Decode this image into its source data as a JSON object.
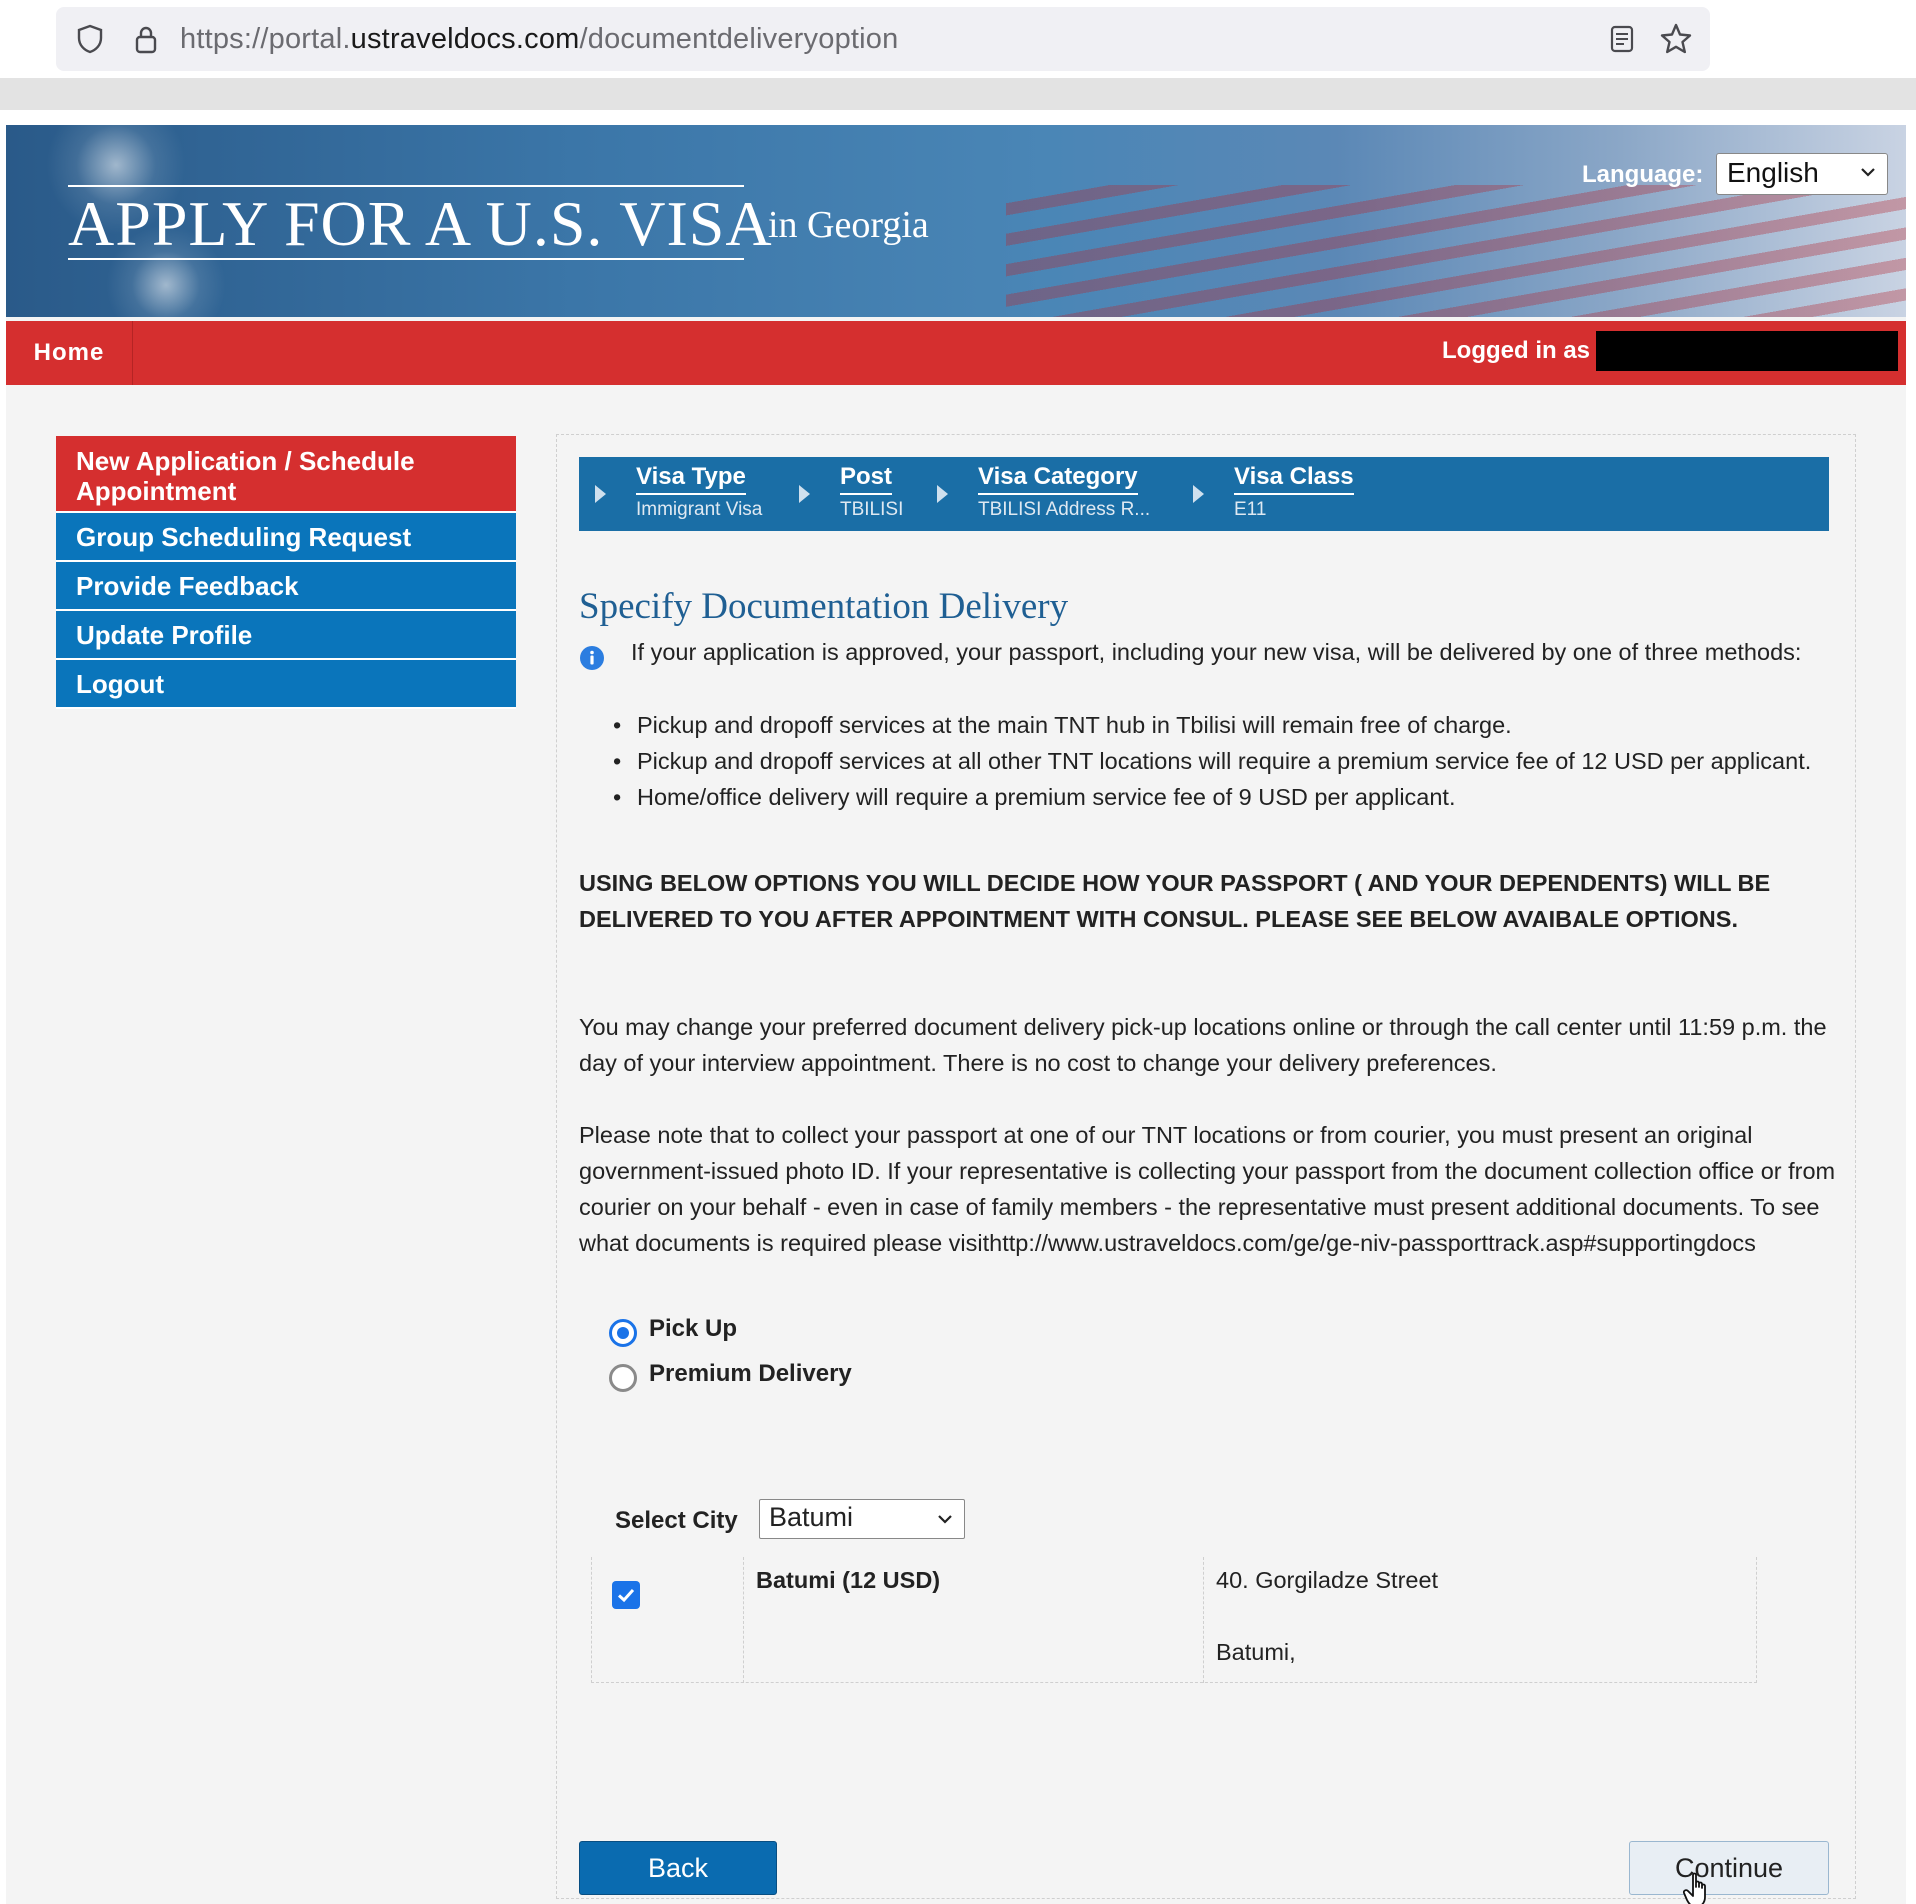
{
  "browser": {
    "url_prefix": "https://portal.",
    "url_domain": "ustraveldocs.com",
    "url_path": "/documentdeliveryoption",
    "icons": [
      "shield-icon",
      "lock-icon",
      "reader-view-icon",
      "bookmark-star-icon"
    ]
  },
  "banner": {
    "title": "APPLY FOR A U.S. VISA",
    "subtitle": "in Georgia",
    "language_label": "Language:",
    "language_value": "English"
  },
  "nav": {
    "home": "Home",
    "logged_in": "Logged in as"
  },
  "sidebar": {
    "items": [
      {
        "label": "New Application / Schedule Appointment"
      },
      {
        "label": "Group Scheduling Request"
      },
      {
        "label": "Provide Feedback"
      },
      {
        "label": "Update Profile"
      },
      {
        "label": "Logout"
      }
    ]
  },
  "breadcrumbs": [
    {
      "title": "Visa Type",
      "value": "Immigrant Visa"
    },
    {
      "title": "Post",
      "value": "TBILISI"
    },
    {
      "title": "Visa Category",
      "value": "TBILISI Address R..."
    },
    {
      "title": "Visa Class",
      "value": "E11"
    }
  ],
  "content": {
    "title": "Specify Documentation Delivery",
    "intro": "If your application is approved, your passport, including your new visa, will be delivered by one of three methods:",
    "bullets": [
      "Pickup and dropoff services at the main TNT hub in Tbilisi will remain free of charge.",
      "Pickup and dropoff services at all other TNT locations will require a premium service fee of 12 USD per applicant.",
      "Home/office delivery will require a premium service fee of 9 USD per applicant."
    ],
    "warning": "USING BELOW OPTIONS YOU WILL DECIDE HOW YOUR PASSPORT ( AND YOUR DEPENDENTS) WILL BE DELIVERED TO YOU AFTER APPOINTMENT WITH CONSUL. PLEASE SEE BELOW AVAIBALE OPTIONS.",
    "para1": "You may change your preferred document delivery pick-up locations online or through the call center until 11:59 p.m. the day of your interview appointment. There is no cost to change your delivery preferences.",
    "para2": "Please note that to collect your passport at one of our TNT locations or from courier, you must present an original government-issued photo ID. If your representative is collecting your passport from the document collection office or from courier on your behalf - even in case of family members - the representative must present additional documents. To see what documents is required please visithttp://www.ustraveldocs.com/ge/ge-niv-passporttrack.asp#supportingdocs"
  },
  "delivery_options": [
    {
      "label": "Pick Up",
      "selected": true
    },
    {
      "label": "Premium Delivery",
      "selected": false
    }
  ],
  "city": {
    "label": "Select City",
    "value": "Batumi"
  },
  "location": {
    "checked": true,
    "name": "Batumi (12 USD)",
    "address_line1": "40. Gorgiladze Street",
    "address_line2": "Batumi,"
  },
  "buttons": {
    "back": "Back",
    "continue": "Continue"
  },
  "colors": {
    "nav_red": "#d52f2f",
    "nav_blue": "#0a75bb",
    "crumb_blue": "#1a6ea6",
    "title_blue": "#1f5f93",
    "radio_blue": "#1a73e8"
  }
}
